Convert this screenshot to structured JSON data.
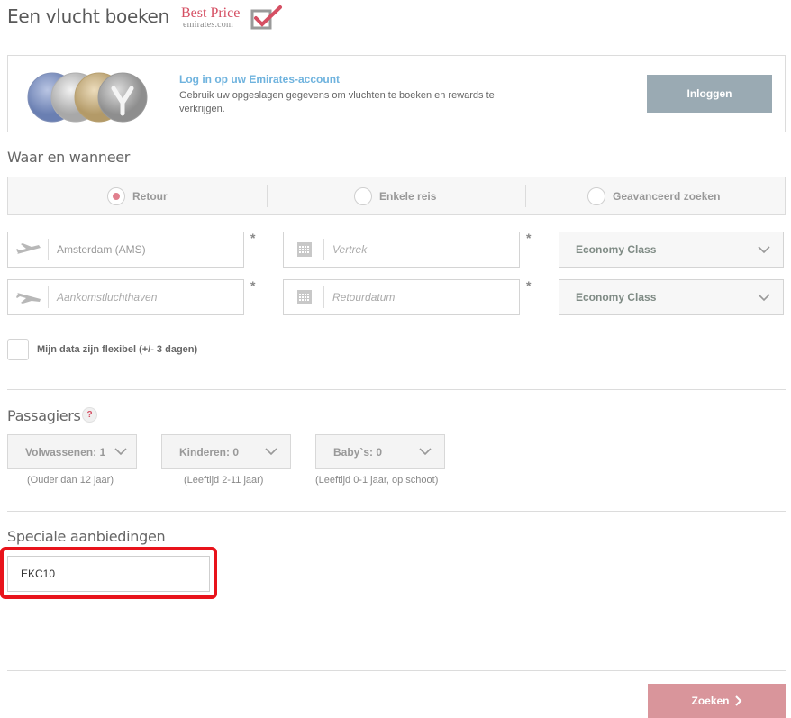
{
  "header": {
    "title": "Een vlucht boeken",
    "logo_main": "Best Price",
    "logo_sub": "emirates.com"
  },
  "login": {
    "title": "Log in op uw Emirates-account",
    "description": "Gebruik uw opgeslagen gegevens om vluchten te boeken en rewards te verkrijgen.",
    "button": "Inloggen"
  },
  "where": {
    "title": "Waar en wanneer",
    "trip_types": [
      {
        "label": "Retour",
        "selected": true
      },
      {
        "label": "Enkele reis",
        "selected": false
      },
      {
        "label": "Geavanceerd zoeken",
        "selected": false
      }
    ],
    "from": {
      "value": "Amsterdam (AMS)",
      "placeholder": ""
    },
    "to": {
      "value": "",
      "placeholder": "Aankomstluchthaven"
    },
    "depart": {
      "value": "",
      "placeholder": "Vertrek"
    },
    "return": {
      "value": "",
      "placeholder": "Retourdatum"
    },
    "class_outbound": "Economy Class",
    "class_return": "Economy Class",
    "required_marker": "*",
    "flexible_label": "Mijn data zijn flexibel (+/- 3 dagen)"
  },
  "passengers": {
    "title": "Passagiers",
    "help": "?",
    "adults": {
      "label": "Volwassenen: 1",
      "hint": "(Ouder dan 12 jaar)"
    },
    "children": {
      "label": "Kinderen: 0",
      "hint": "(Leeftijd 2-11 jaar)"
    },
    "infants": {
      "label": "Baby`s: 0",
      "hint": "(Leeftijd 0-1 jaar, op schoot)"
    }
  },
  "offers": {
    "title": "Speciale aanbiedingen",
    "promo_code": "EKC10"
  },
  "search": {
    "button": "Zoeken",
    "arrow": "›"
  },
  "colors": {
    "brand_red": "#d54f63",
    "link_blue": "#6fb3de",
    "login_button": "#9aaab3",
    "search_button": "#d9959b",
    "highlight": "#e8131b"
  },
  "icons": [
    "checkmark-icon",
    "coins-icon",
    "plane-takeoff-icon",
    "plane-landing-icon",
    "calendar-icon",
    "chevron-down-icon",
    "chevron-right-icon"
  ]
}
